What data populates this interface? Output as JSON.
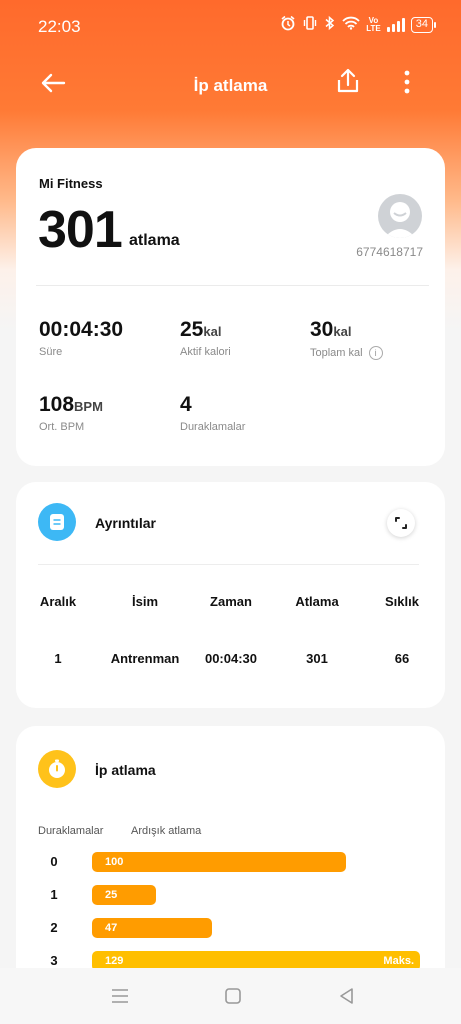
{
  "status_bar": {
    "time": "22:03",
    "battery": "34"
  },
  "header": {
    "title": "İp atlama"
  },
  "summary": {
    "source": "Mi Fitness",
    "count": "301",
    "count_unit": "atlama",
    "user_id": "6774618717",
    "stats": {
      "duration": {
        "value": "00:04:30",
        "label": "Süre"
      },
      "active_calories": {
        "value": "25",
        "unit": "kal",
        "label": "Aktif kalori"
      },
      "total_calories": {
        "value": "30",
        "unit": "kal",
        "label": "Toplam kal"
      },
      "avg_bpm": {
        "value": "108",
        "unit": "BPM",
        "label": "Ort. BPM"
      },
      "pauses": {
        "value": "4",
        "label": "Duraklamalar"
      }
    }
  },
  "details": {
    "title": "Ayrıntılar",
    "columns": [
      "Aralık",
      "İsim",
      "Zaman",
      "Atlama",
      "Sıklık"
    ],
    "rows": [
      [
        "1",
        "Antrenman",
        "00:04:30",
        "301",
        "66"
      ]
    ]
  },
  "jump_rope": {
    "title": "İp atlama",
    "legend": {
      "pauses": "Duraklamalar",
      "consecutive": "Ardışık atlama"
    },
    "max_label": "Maks.",
    "bar_color": "#ff9c00",
    "max_bar_color": "#ffbf00",
    "bars": [
      {
        "label": "0",
        "value": 100
      },
      {
        "label": "1",
        "value": 25
      },
      {
        "label": "2",
        "value": 47
      },
      {
        "label": "3",
        "value": 129
      }
    ]
  },
  "colors": {
    "accent": "#ff6a2c",
    "details_icon": "#3db8f5",
    "jump_icon": "#ffc21a"
  }
}
